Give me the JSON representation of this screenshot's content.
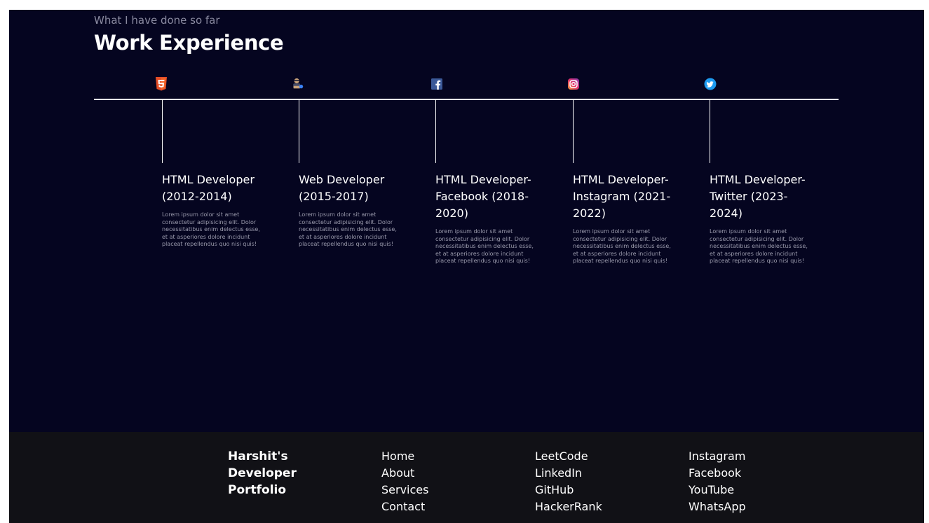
{
  "header": {
    "subtitle": "What I have done so far",
    "title": "Work Experience"
  },
  "experiences": [
    {
      "icon": "html5-icon",
      "title": "HTML Developer (2012-2014)",
      "description": "Lorem ipsum dolor sit amet consectetur adipisicing elit. Dolor necessitatibus enim delectus esse, et at asperiores dolore incidunt placeat repellendus quo nisi quis!"
    },
    {
      "icon": "developer-avatar-icon",
      "title": "Web Developer (2015-2017)",
      "description": "Lorem ipsum dolor sit amet consectetur adipisicing elit. Dolor necessitatibus enim delectus esse, et at asperiores dolore incidunt placeat repellendus quo nisi quis!"
    },
    {
      "icon": "facebook-icon",
      "title": "HTML Developer-Facebook (2018-2020)",
      "description": "Lorem ipsum dolor sit amet consectetur adipisicing elit. Dolor necessitatibus enim delectus esse, et at asperiores dolore incidunt placeat repellendus quo nisi quis!"
    },
    {
      "icon": "instagram-icon",
      "title": "HTML Developer-Instagram (2021-2022)",
      "description": "Lorem ipsum dolor sit amet consectetur adipisicing elit. Dolor necessitatibus enim delectus esse, et at asperiores dolore incidunt placeat repellendus quo nisi quis!"
    },
    {
      "icon": "twitter-icon",
      "title": "HTML Developer-Twitter (2023-2024)",
      "description": "Lorem ipsum dolor sit amet consectetur adipisicing elit. Dolor necessitatibus enim delectus esse, et at asperiores dolore incidunt placeat repellendus quo nisi quis!"
    }
  ],
  "footer": {
    "brand": "Harshit's Developer Portfolio",
    "nav": [
      "Home",
      "About",
      "Services",
      "Contact"
    ],
    "coding": [
      "LeetCode",
      "LinkedIn",
      "GitHub",
      "HackerRank"
    ],
    "social": [
      "Instagram",
      "Facebook",
      "YouTube",
      "WhatsApp"
    ]
  },
  "colors": {
    "background": "#050520",
    "footer": "#111116",
    "text": "#ffffff",
    "muted": "#9a9aac",
    "html5": "#e44d26",
    "facebook": "#3b5998",
    "twitter": "#1d9bf0"
  }
}
